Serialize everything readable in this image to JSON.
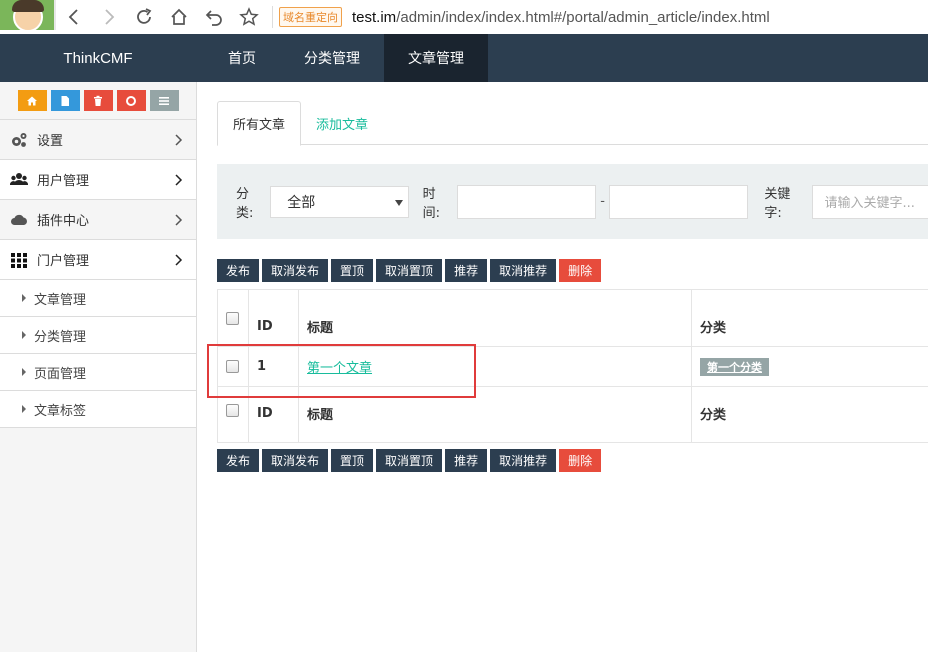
{
  "browser": {
    "redirect_badge": "域名重定向",
    "url_host": "test.im",
    "url_path": "/admin/index/index.html#/portal/admin_article/index.html"
  },
  "topnav": {
    "brand": "ThinkCMF",
    "items": [
      {
        "label": "首页",
        "active": false
      },
      {
        "label": "分类管理",
        "active": false
      },
      {
        "label": "文章管理",
        "active": true
      }
    ],
    "bg_color": "#2c3e50"
  },
  "sidebar": {
    "quick_buttons": [
      {
        "icon": "home-icon",
        "color": "#f39c12"
      },
      {
        "icon": "file-icon",
        "color": "#3498db"
      },
      {
        "icon": "trash-icon",
        "color": "#e74c3c"
      },
      {
        "icon": "recycle-icon",
        "color": "#e74c3c"
      },
      {
        "icon": "list-icon",
        "color": "#95a5a6"
      }
    ],
    "menu": [
      {
        "label": "设置",
        "icon": "gears-icon"
      },
      {
        "label": "用户管理",
        "icon": "users-icon"
      },
      {
        "label": "插件中心",
        "icon": "cloud-icon"
      },
      {
        "label": "门户管理",
        "icon": "grid-icon"
      }
    ],
    "sub_items": [
      "文章管理",
      "分类管理",
      "页面管理",
      "文章标签"
    ]
  },
  "tabs": [
    {
      "label": "所有文章",
      "active": true
    },
    {
      "label": "添加文章",
      "active": false
    }
  ],
  "filter": {
    "category_label": "分类:",
    "category_value": "全部",
    "time_label": "时间:",
    "time_separator": "-",
    "keyword_label": "关键字:",
    "keyword_placeholder": "请输入关键字..."
  },
  "actions": [
    "发布",
    "取消发布",
    "置顶",
    "取消置顶",
    "推荐",
    "取消推荐",
    "删除"
  ],
  "table": {
    "headers": {
      "id": "ID",
      "title": "标题",
      "category": "分类"
    },
    "rows": [
      {
        "id": "1",
        "title": "第一个文章",
        "category": "第一个分类"
      }
    ]
  },
  "accent_color": "#18bc9c",
  "danger_color": "#e74c3c"
}
